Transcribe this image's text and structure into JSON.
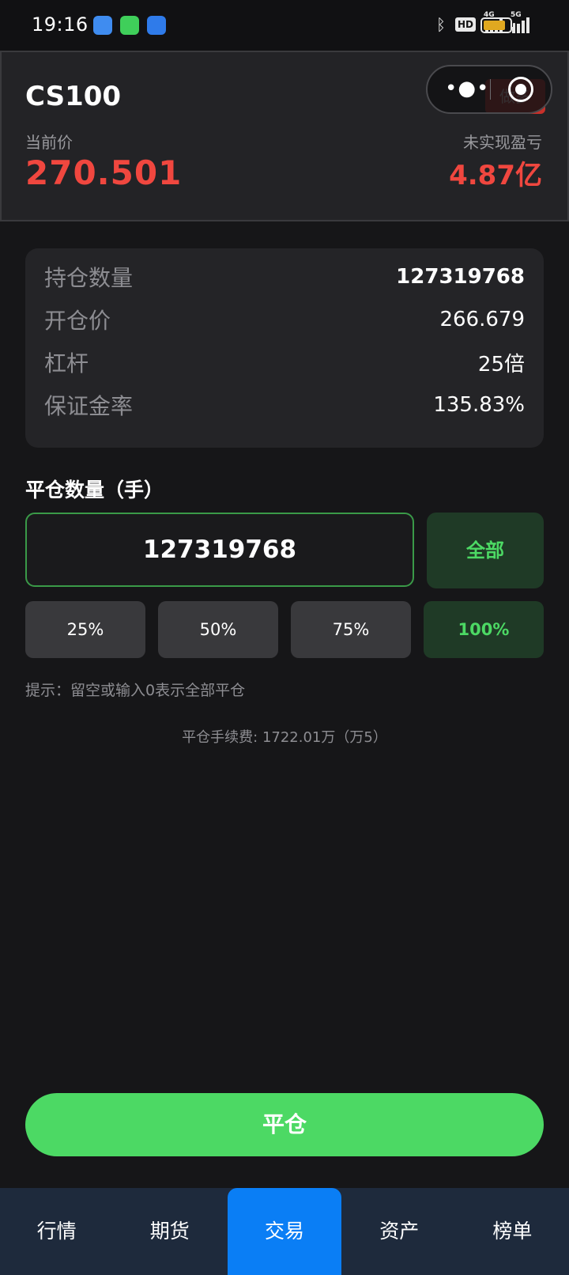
{
  "status_bar": {
    "time": "19:16",
    "hd_label": "HD",
    "net1": "4G",
    "net2": "5G",
    "battery_level": 0.85,
    "battery_color": "#e0a820"
  },
  "header": {
    "title": "CS100",
    "price_label": "当前价",
    "price": "270.501",
    "pnl_label": "未实现盈亏",
    "pnl": "4.87亿",
    "badge": "做多",
    "price_color": "#f0473f"
  },
  "position": {
    "rows": [
      {
        "label": "持仓数量",
        "value": "127319768"
      },
      {
        "label": "开仓价",
        "value": "266.679"
      },
      {
        "label": "杠杆",
        "value": "25倍"
      },
      {
        "label": "保证金率",
        "value": "135.83%"
      }
    ]
  },
  "close_form": {
    "label": "平仓数量（手）",
    "quantity": "127319768",
    "all_label": "全部",
    "percent_options": [
      "25%",
      "50%",
      "75%",
      "100%"
    ],
    "selected_percent": "100%",
    "hint": "提示：留空或输入0表示全部平仓",
    "fee": "平仓手续费: 1722.01万（万5）",
    "submit_label": "平仓",
    "accent_color": "#4cd964"
  },
  "nav": {
    "items": [
      "行情",
      "期货",
      "交易",
      "资产",
      "榜单"
    ],
    "active": "交易",
    "active_color": "#0a7ef5"
  },
  "icons": {
    "bluetooth": "bluetooth-icon",
    "more": "more-dots-icon",
    "record": "record-icon"
  }
}
